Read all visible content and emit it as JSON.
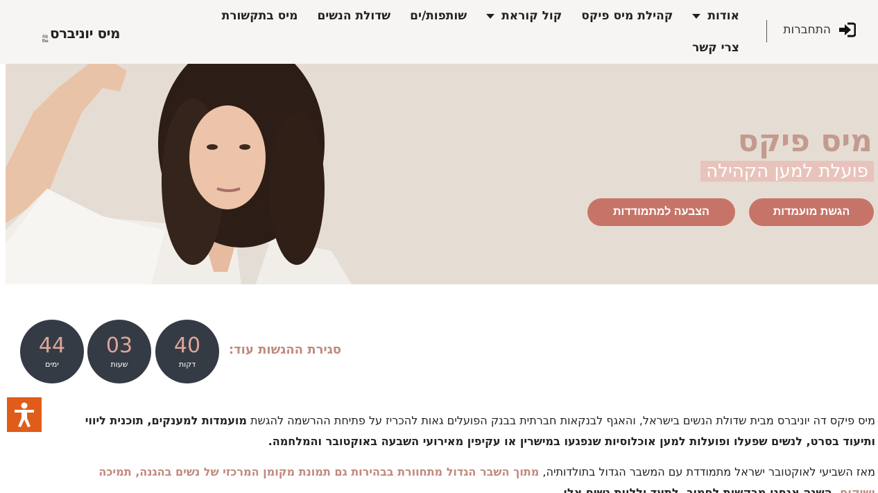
{
  "header": {
    "login_label": "התחברות",
    "nav": {
      "row1": [
        {
          "label": "אודות",
          "dropdown": true
        },
        {
          "label": "קהילת מיס פיקס",
          "dropdown": false
        },
        {
          "label": "קול קוראת",
          "dropdown": true
        },
        {
          "label": "שותפות/ים",
          "dropdown": false
        },
        {
          "label": "שדולת הנשים",
          "dropdown": false
        },
        {
          "label": "מיס בתקשורת",
          "dropdown": false
        }
      ],
      "row2": [
        {
          "label": "צרי קשר"
        }
      ]
    },
    "logo": {
      "text": "מיס יוניברס",
      "small": "FIX the"
    }
  },
  "hero": {
    "title": "מיס פיקס",
    "subtitle": "פועלת למען הקהילה",
    "primary_button": "הגשת מועמדות",
    "secondary_button": "הצבעה למתמודדות",
    "colors": {
      "background": "#e5ddd3",
      "title": "#c49a8f",
      "button": "#c77468"
    }
  },
  "countdown": {
    "label": "סגירת ההגשות עוד:",
    "minutes": {
      "value": "40",
      "unit": "דקות"
    },
    "hours": {
      "value": "03",
      "unit": "שעות"
    },
    "days": {
      "value": "44",
      "unit": "ימים"
    }
  },
  "content": {
    "p1": {
      "t1": "מיס פיקס דה יוניברס מבית שדולת הנשים בישראל, והאגף לבנקאות חברתית בבנק הפועלים גאות להכריז על פתיחת ההרשמה להגשת ",
      "t2": "מועמדות למענקים, תוכנית ליווי",
      "t3": "ותיעוד בסרט, לנשים שפעלו ופועלות למען אוכלוסיות שנפגעו במישרין או עקיפין מאירועי השבעה באוקטובר והמלחמה."
    },
    "p2": {
      "t1": "מאז השביעי לאוקטובר ישראל מתמודדת עם המשבר הגדול בתולדותיה, ",
      "t2": "מתוך השבר הגדול מתחוורת בבהירות גם תמונת מקומן המרכזי של נשים בהגנה, תמיכה",
      "t3": "ושיקום",
      "t4": ". השנה אנחנו מבקשות לחמוך, לתעד וללוות נשים אלו"
    }
  }
}
